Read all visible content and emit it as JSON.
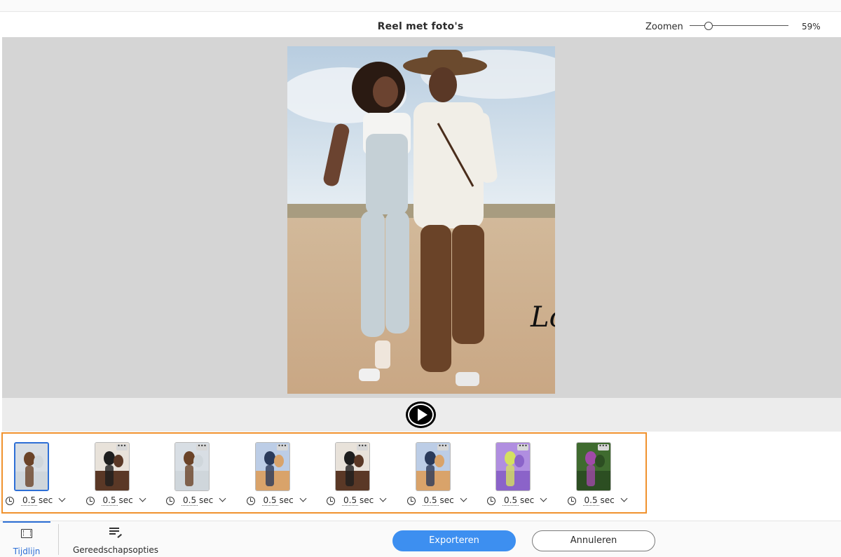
{
  "header": {
    "title": "Reel met foto's",
    "zoom_label": "Zoomen",
    "zoom_value": "59%",
    "zoom_level": 0.59
  },
  "preview": {
    "overlay_text": "Lo",
    "image": "couple-walking-photo"
  },
  "player": {
    "play_icon": "play-icon"
  },
  "timeline": {
    "accent": "#f0922e",
    "clips": [
      {
        "thumbnail": "couple-walking",
        "duration": "0.5",
        "unit": "sec",
        "selected": true
      },
      {
        "thumbnail": "couple-hat-kiss",
        "duration": "0.5",
        "unit": "sec",
        "selected": false
      },
      {
        "thumbnail": "couple-walking",
        "duration": "0.5",
        "unit": "sec",
        "selected": false
      },
      {
        "thumbnail": "couple-hug",
        "duration": "0.5",
        "unit": "sec",
        "selected": false
      },
      {
        "thumbnail": "couple-hat-kiss",
        "duration": "0.5",
        "unit": "sec",
        "selected": false
      },
      {
        "thumbnail": "couple-hug",
        "duration": "0.5",
        "unit": "sec",
        "selected": false
      },
      {
        "thumbnail": "purple-flowers",
        "duration": "0.5",
        "unit": "sec",
        "selected": false
      },
      {
        "thumbnail": "hummingbird",
        "duration": "0.5",
        "unit": "sec",
        "selected": false
      }
    ]
  },
  "footer": {
    "tab_timeline": "Tijdlijn",
    "tab_tools": "Gereedschapsopties",
    "export_label": "Exporteren",
    "cancel_label": "Annuleren",
    "accent": "#2d6fd6",
    "export_color": "#3d8ff0"
  }
}
